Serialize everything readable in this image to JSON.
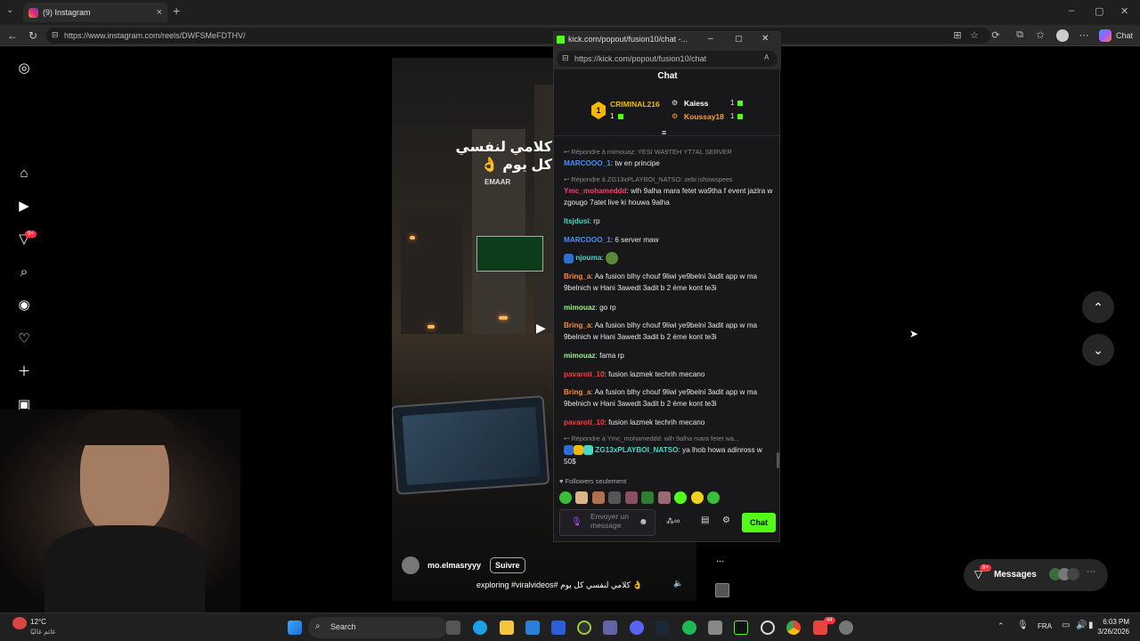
{
  "browser": {
    "tab_title": "(9) Instagram",
    "url": "https://www.instagram.com/reels/DWFSMeFDTHV/",
    "url_host": "www.instagram.com",
    "profile_label": "Chat"
  },
  "instagram": {
    "notifications_badge": "9+",
    "video_overlay_text": "كلامي لنفسي كل يوم 👌",
    "video_sign": "EMAAR",
    "author": "mo.elmasryyy",
    "follow_label": "Suivre",
    "caption": "exploring #viralvideos# كلامي لنفسي كل يوم 👌",
    "more_label": "...",
    "messages_label": "Messages",
    "messages_badge": "9+"
  },
  "popup": {
    "window_title": "kick.com/popout/fusion10/chat -...",
    "url": "https://kick.com/popout/fusion10/chat",
    "chat_title": "Chat",
    "leaderboard": [
      {
        "rank": "1",
        "name": "CRIMINAL216",
        "count": "1",
        "color": "#f5b700"
      },
      {
        "name": "Kaiess",
        "count": "1",
        "color": "#ffffff"
      },
      {
        "name": "Koussay18",
        "count": "1",
        "color": "#f5a623"
      }
    ],
    "messages": [
      {
        "reply": "Répondre à mimouaz: YESI WA9TEH YT7AL SERVER",
        "user": "MARCOOO_1",
        "color": "#4a8cff",
        "text": "tw en principe"
      },
      {
        "reply": "Répondre à ZG13xPLAYBOI_NATSO: zebi ishowspees",
        "user": "Ymc_mohameddd",
        "color": "#ff3b6b",
        "text": "wlh 9alha mara fetet wa9tha f event jazira w zgougo 7atet live ki houwa 9alha"
      },
      {
        "user": "Itsjdusi",
        "color": "#4ad6c9",
        "text": "rp"
      },
      {
        "user": "MARCOOO_1",
        "color": "#4a8cff",
        "text": "6 server maw"
      },
      {
        "user": "njouma",
        "color": "#4ad6c9",
        "text": ""
      },
      {
        "user": "Bring_a",
        "color": "#ff8a3d",
        "text": "Aa fusion blhy chouf 9liwi ye9belni 3adit app w ma 9belnich w Hani 3awedt 3adit b 2 éme kont te3i"
      },
      {
        "user": "mimouaz",
        "color": "#9ff08c",
        "text": "go rp"
      },
      {
        "user": "Bring_a",
        "color": "#ff8a3d",
        "text": "Aa fusion blhy chouf 9liwi ye9belni 3adit app w ma 9belnich w Hani 3awedt 3adit b 2 éme kont te3i"
      },
      {
        "user": "mimouaz",
        "color": "#9ff08c",
        "text": "fama rp"
      },
      {
        "user": "pavaroti_10",
        "color": "#ff3b3b",
        "text": "fusion lazmek techrih mecano"
      },
      {
        "user": "Bring_a",
        "color": "#ff8a3d",
        "text": "Aa fusion blhy chouf 9liwi ye9belni 3adit app w ma 9belnich w Hani 3awedt 3adit b 2 éme kont te3i"
      },
      {
        "user": "pavaroti_10",
        "color": "#ff3b3b",
        "text": "fusion lazmek techrih mecano"
      },
      {
        "reply": "Répondre à Ymc_mohameddd: wlh 9alha mara fetet wa...",
        "user": "ZG13xPLAYBOI_NATSO",
        "color": "#4ad6c9",
        "text": "ya lhob howa adinross w 50$"
      }
    ],
    "followers_only": "Followers seulement",
    "input_placeholder": "Envoyer un message",
    "send_label": "Chat"
  },
  "taskbar": {
    "weather_temp": "12°C",
    "weather_sub": "غائم غالبًا",
    "search_label": "Search",
    "lang": "FRA",
    "time": "6:03 PM",
    "date": "3/26/2026",
    "app_badge": "44"
  }
}
